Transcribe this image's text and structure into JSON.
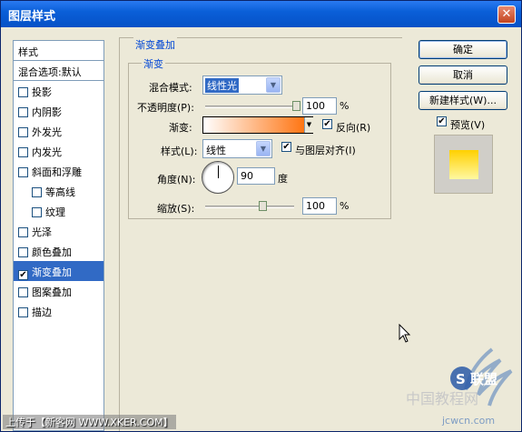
{
  "window": {
    "title": "图层样式",
    "close_glyph": "✕"
  },
  "list": {
    "header": "样式",
    "blend_options": "混合选项:默认",
    "items": [
      {
        "label": "投影",
        "checked": false,
        "indent": false,
        "selected": false
      },
      {
        "label": "内阴影",
        "checked": false,
        "indent": false,
        "selected": false
      },
      {
        "label": "外发光",
        "checked": false,
        "indent": false,
        "selected": false
      },
      {
        "label": "内发光",
        "checked": false,
        "indent": false,
        "selected": false
      },
      {
        "label": "斜面和浮雕",
        "checked": false,
        "indent": false,
        "selected": false
      },
      {
        "label": "等高线",
        "checked": false,
        "indent": true,
        "selected": false
      },
      {
        "label": "纹理",
        "checked": false,
        "indent": true,
        "selected": false
      },
      {
        "label": "光泽",
        "checked": false,
        "indent": false,
        "selected": false
      },
      {
        "label": "颜色叠加",
        "checked": false,
        "indent": false,
        "selected": false
      },
      {
        "label": "渐变叠加",
        "checked": true,
        "indent": false,
        "selected": true
      },
      {
        "label": "图案叠加",
        "checked": false,
        "indent": false,
        "selected": false
      },
      {
        "label": "描边",
        "checked": false,
        "indent": false,
        "selected": false
      }
    ]
  },
  "panel": {
    "group_title": "渐变叠加",
    "subgroup_title": "渐变",
    "blend_mode_label": "混合模式:",
    "blend_mode_value": "线性光",
    "opacity_label": "不透明度(P):",
    "opacity_value": "100",
    "opacity_unit": "%",
    "opacity_level": 1.0,
    "gradient_label": "渐变:",
    "gradient_colors": [
      "#ffffff",
      "#ff6a00"
    ],
    "reverse_label": "反向(R)",
    "reverse_checked": true,
    "style_label": "样式(L):",
    "style_value": "线性",
    "align_label": "与图层对齐(I)",
    "align_checked": true,
    "angle_label": "角度(N):",
    "angle_value": "90",
    "angle_unit": "度",
    "scale_label": "缩放(S):",
    "scale_value": "100",
    "scale_unit": "%",
    "scale_level": 0.5
  },
  "buttons": {
    "ok": "确定",
    "cancel": "取消",
    "new_style": "新建样式(W)...",
    "preview_label": "预览(V)",
    "preview_checked": true
  },
  "watermark": {
    "text": "上传于【新客网 WWW.XKER.COM】",
    "logo_text": "中国教程网",
    "logo_brand": "S 联盟",
    "logo_url": "jcwcn.com"
  },
  "colors": {
    "selection": "#316ac5",
    "group_title": "#0046d5",
    "preview_top": "#ffd000",
    "preview_bottom": "#fff8a0"
  },
  "icons": {
    "checkmark": "✔",
    "dropdown": "▼",
    "mouse_cursor": "arrow-cursor-icon"
  }
}
